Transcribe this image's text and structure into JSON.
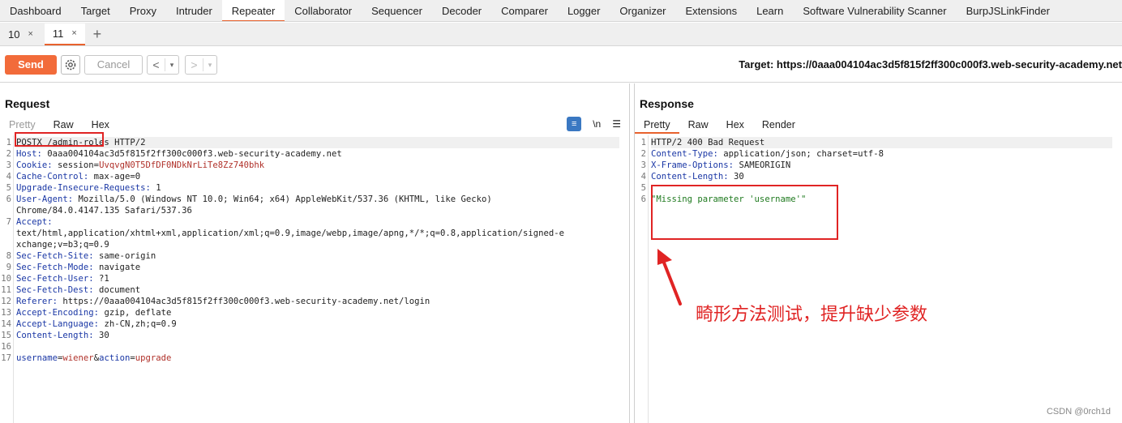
{
  "top_tabs": [
    {
      "label": "Dashboard"
    },
    {
      "label": "Target"
    },
    {
      "label": "Proxy"
    },
    {
      "label": "Intruder"
    },
    {
      "label": "Repeater",
      "active": true
    },
    {
      "label": "Collaborator"
    },
    {
      "label": "Sequencer"
    },
    {
      "label": "Decoder"
    },
    {
      "label": "Comparer"
    },
    {
      "label": "Logger"
    },
    {
      "label": "Organizer"
    },
    {
      "label": "Extensions"
    },
    {
      "label": "Learn"
    },
    {
      "label": "Software Vulnerability Scanner"
    },
    {
      "label": "BurpJSLinkFinder"
    }
  ],
  "repeater_tabs": [
    {
      "label": "10",
      "close": "×"
    },
    {
      "label": "11",
      "close": "×",
      "active": true
    }
  ],
  "add_tab": "+",
  "toolbar": {
    "send_label": "Send",
    "settings_icon": "gear-icon",
    "cancel_label": "Cancel",
    "back": "<",
    "forward": ">",
    "dropdown": "▾",
    "target_label": "Target: https://0aaa004104ac3d5f815f2ff300c000f3.web-security-academy.net"
  },
  "request": {
    "title": "Request",
    "tabs": [
      "Pretty",
      "Raw",
      "Hex"
    ],
    "active_tab": "Raw",
    "icons": {
      "wrap": "≡",
      "newline": "\\n",
      "menu": "☰"
    },
    "lines": [
      {
        "n": "1",
        "key": "",
        "val": "POSTX /admin-roles HTTP/2"
      },
      {
        "n": "2",
        "key": "Host:",
        "val": " 0aaa004104ac3d5f815f2ff300c000f3.web-security-academy.net"
      },
      {
        "n": "3",
        "key": "Cookie:",
        "val": " session=",
        "cookie": "UvqvgN0T5DfDF0NDkNrLiTe8Zz740bhk"
      },
      {
        "n": "4",
        "key": "Cache-Control:",
        "val": " max-age=0"
      },
      {
        "n": "5",
        "key": "Upgrade-Insecure-Requests:",
        "val": " 1"
      },
      {
        "n": "6",
        "key": "User-Agent:",
        "val": " Mozilla/5.0 (Windows NT 10.0; Win64; x64) AppleWebKit/537.36 (KHTML, like Gecko)"
      },
      {
        "n": "",
        "key": "",
        "val": "Chrome/84.0.4147.135 Safari/537.36"
      },
      {
        "n": "7",
        "key": "Accept:",
        "val": ""
      },
      {
        "n": "",
        "key": "",
        "val": "text/html,application/xhtml+xml,application/xml;q=0.9,image/webp,image/apng,*/*;q=0.8,application/signed-e"
      },
      {
        "n": "",
        "key": "",
        "val": "xchange;v=b3;q=0.9"
      },
      {
        "n": "8",
        "key": "Sec-Fetch-Site:",
        "val": " same-origin"
      },
      {
        "n": "9",
        "key": "Sec-Fetch-Mode:",
        "val": " navigate"
      },
      {
        "n": "10",
        "key": "Sec-Fetch-User:",
        "val": " ?1"
      },
      {
        "n": "11",
        "key": "Sec-Fetch-Dest:",
        "val": " document"
      },
      {
        "n": "12",
        "key": "Referer:",
        "val": " https://0aaa004104ac3d5f815f2ff300c000f3.web-security-academy.net/login"
      },
      {
        "n": "13",
        "key": "Accept-Encoding:",
        "val": " gzip, deflate"
      },
      {
        "n": "14",
        "key": "Accept-Language:",
        "val": " zh-CN,zh;q=0.9"
      },
      {
        "n": "15",
        "key": "Content-Length:",
        "val": " 30"
      },
      {
        "n": "16",
        "key": "",
        "val": ""
      },
      {
        "n": "17",
        "key": "",
        "val": "",
        "body": true
      }
    ],
    "body_params": {
      "k1": "username",
      "eq1": "=",
      "v1": "wiener",
      "amp": "&",
      "k2": "action",
      "eq2": "=",
      "v2": "upgrade"
    }
  },
  "response": {
    "title": "Response",
    "tabs": [
      "Pretty",
      "Raw",
      "Hex",
      "Render"
    ],
    "active_tab": "Pretty",
    "lines": [
      {
        "n": "1",
        "key": "",
        "val": "HTTP/2 400 Bad Request"
      },
      {
        "n": "2",
        "key": "Content-Type:",
        "val": " application/json; charset=utf-8"
      },
      {
        "n": "3",
        "key": "X-Frame-Options:",
        "val": " SAMEORIGIN"
      },
      {
        "n": "4",
        "key": "Content-Length:",
        "val": " 30"
      },
      {
        "n": "5",
        "key": "",
        "val": ""
      },
      {
        "n": "6",
        "key": "",
        "val": "",
        "str": "\"Missing parameter 'username'\""
      }
    ]
  },
  "annotation": {
    "text": "畸形方法测试，提升缺少参数",
    "color": "#e02424"
  },
  "watermark": "CSDN @0rch1d",
  "colors": {
    "accent": "#e8622d",
    "send_button": "#f26b3a",
    "header_key": "#1a37a5",
    "param_value": "#b0312a",
    "json_string": "#1f7a1f"
  }
}
